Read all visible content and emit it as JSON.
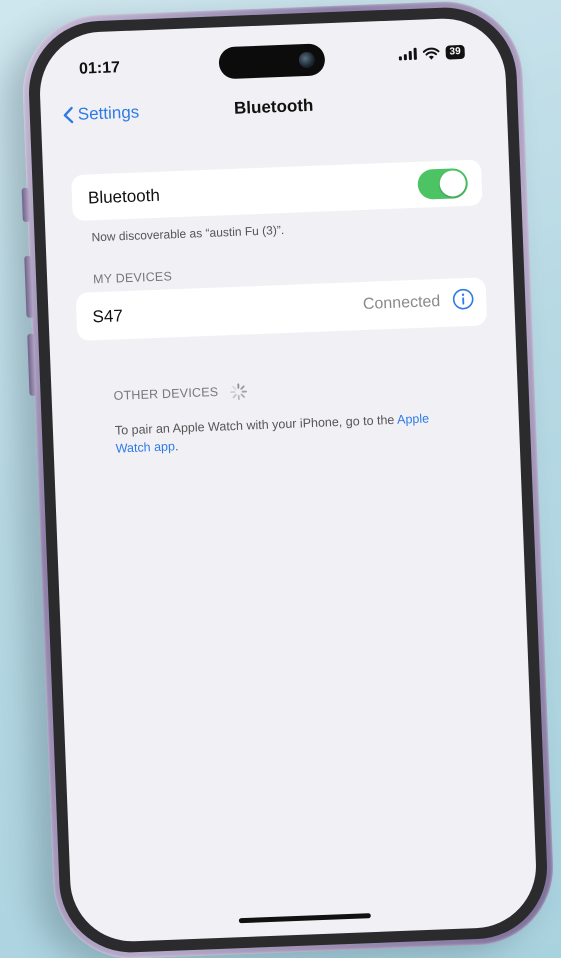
{
  "status_bar": {
    "time": "01:17",
    "battery": "39",
    "icons": [
      "signal-icon",
      "wifi-icon",
      "battery-icon"
    ]
  },
  "nav": {
    "back_label": "Settings",
    "title": "Bluetooth"
  },
  "bluetooth": {
    "label": "Bluetooth",
    "enabled": true,
    "discoverable_note": "Now discoverable as “austin Fu (3)”."
  },
  "my_devices": {
    "header": "MY DEVICES",
    "items": [
      {
        "name": "S47",
        "status": "Connected"
      }
    ]
  },
  "other_devices": {
    "header": "OTHER DEVICES",
    "pair_text": "To pair an Apple Watch with your iPhone, go to the ",
    "pair_link": "Apple Watch app",
    "pair_end": "."
  },
  "colors": {
    "accent": "#2f7ae5",
    "toggle_on": "#4cc463",
    "background": "#f1f1f5"
  }
}
